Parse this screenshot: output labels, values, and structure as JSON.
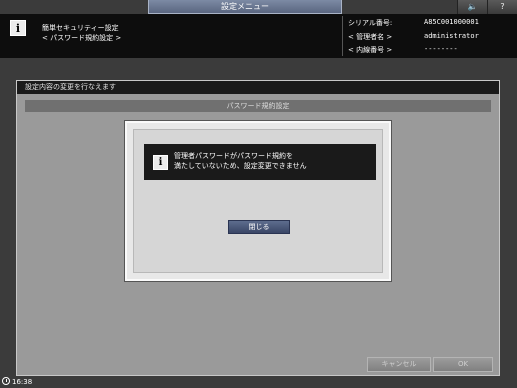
{
  "top_bar": {
    "menu_title": "設定メニュー",
    "volume_icon": "speaker-icon",
    "help_label": "?"
  },
  "header": {
    "line1": "簡単セキュリティー設定",
    "line2": "< パスワード規約設定 >",
    "serial_label": "シリアル番号:",
    "serial_value": "A85C001000001",
    "admin_label": "< 管理者名 >",
    "admin_value": "administrator",
    "ext_label": "< 内線番号 >",
    "ext_value": "--------"
  },
  "main": {
    "instruction": "設定内容の変更を行なえます",
    "panel_title": "パスワード規約設定",
    "cancel_label": "キャンセル",
    "ok_label": "OK"
  },
  "dialog": {
    "message_line1": "管理者パスワードがパスワード規約を",
    "message_line2": "満たしていないため、設定変更できません",
    "close_label": "閉じる"
  },
  "status": {
    "time": "16:38"
  }
}
